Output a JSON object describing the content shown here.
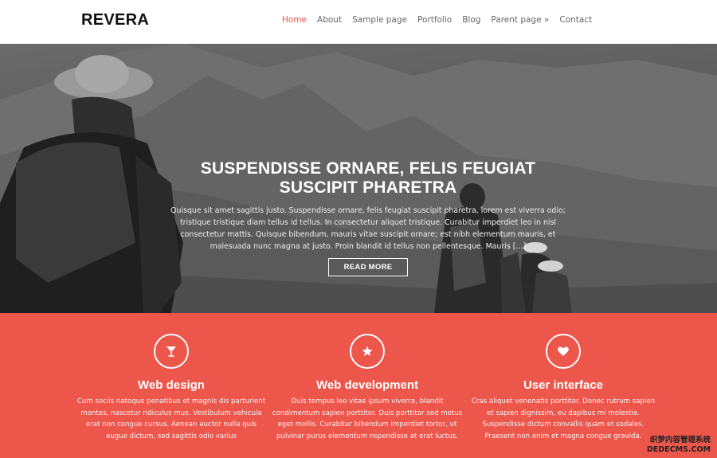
{
  "header": {
    "logo": "REVERA",
    "nav": [
      {
        "label": "Home",
        "active": true
      },
      {
        "label": "About"
      },
      {
        "label": "Sample page"
      },
      {
        "label": "Portfolio"
      },
      {
        "label": "Blog"
      },
      {
        "label": "Parent page »"
      },
      {
        "label": "Contact"
      }
    ]
  },
  "hero": {
    "title": "SUSPENDISSE ORNARE, FELIS FEUGIAT SUSCIPIT PHARETRA",
    "text": "Quisque sit amet sagittis justo. Suspendisse ornare, felis feugiat suscipit pharetra, lorem est viverra odio; tristique tristique diam tellus id tellus. In consectetur aliquet tristique. Curabitur imperdiet leo in nisl consectetur mattis. Quisque bibendum, mauris vitae suscipit ornare; est nibh elementum mauris, et malesuada nunc magna at justo. Proin blandit id tellus non pellentesque. Mauris […]",
    "button": "READ MORE"
  },
  "features": [
    {
      "icon": "cocktail-icon",
      "title": "Web design",
      "text": "Cum sociis natoque penatibus et magnis dis parturient montes, nascetur ridiculus mus. Vestibulum vehicula erat non congue cursus. Aenean auctor nulla quis augue dictum, sed sagittis odio varius"
    },
    {
      "icon": "star-icon",
      "title": "Web development",
      "text": "Duis tempus leo vitae ipsum viverra, blandit condimentum sapien porttitor. Duis porttitor sed metus eget mollis. Curabitur bibendum imperdiet tortor, ut pulvinar purus elementum nspendisse at erat luctus."
    },
    {
      "icon": "heart-icon",
      "title": "User interface",
      "text": "Cras aliquet venenatis porttitor. Donec rutrum sapien et sapien dignissim, eu dapibus mi molestie. Suspendisse dictum convallis quam et sodales. Praesent non enim et magna congue gravida."
    }
  ],
  "watermark": {
    "line1": "织梦内容管理系统",
    "line2": "DEDECMS.COM"
  }
}
